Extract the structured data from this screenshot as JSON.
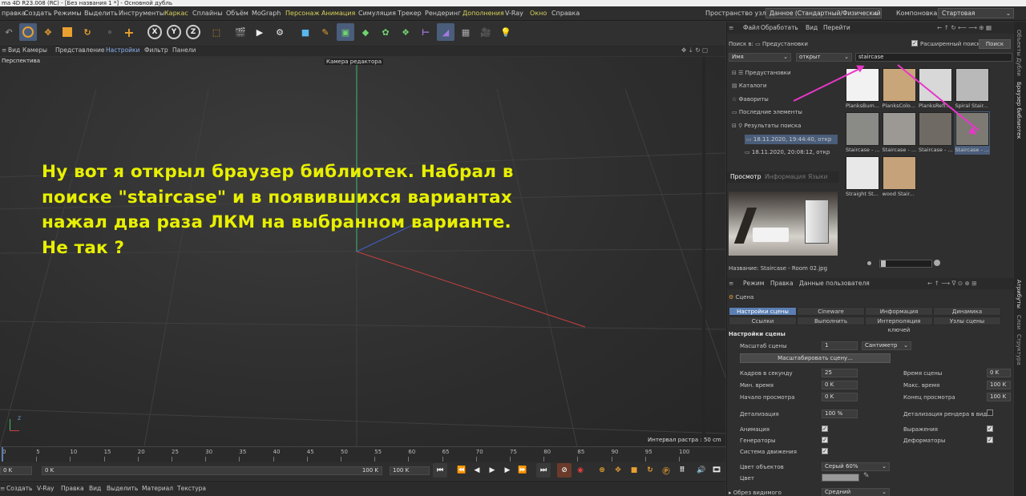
{
  "window": {
    "title": "ma 4D R23.008 (RC) - [Без названия 1 *] - Основной дубль"
  },
  "menubar": {
    "items": [
      "правка",
      "Создать",
      "Режимы",
      "Выделить",
      "Инструменты",
      "Каркас",
      "Сплайны",
      "Объём",
      "MoGraph",
      "Персонаж",
      "Анимация",
      "Симуляция",
      "Трекер",
      "Рендеринг",
      "Дополнения",
      "V-Ray",
      "Окно",
      "Справка"
    ],
    "node_space_label": "Пространство узлов:",
    "node_space_value": "Данное (Стандартный/Физический)",
    "layout_label": "Компоновка",
    "layout_value": "Стартовая"
  },
  "toolbar": {
    "icons": [
      "undo-icon",
      "select-icon",
      "move-icon",
      "scale-icon",
      "rotate-icon",
      "pen-icon",
      "add-icon",
      "x-axis-icon",
      "y-axis-icon",
      "z-axis-icon",
      "coord-system-icon",
      "clapper-icon",
      "render-view-icon",
      "render-settings-icon",
      "cube-icon",
      "pen-tool-icon",
      "subdivision-icon",
      "extrude-icon",
      "cloner-icon",
      "mograph-icon",
      "deformer-icon",
      "spline-icon",
      "floor-icon",
      "camera-icon",
      "light-icon"
    ],
    "xyz": [
      "X",
      "Y",
      "Z"
    ]
  },
  "viewport": {
    "menu": [
      "Вид",
      "Камеры",
      "Представление",
      "Настройки",
      "Фильтр",
      "Панели"
    ],
    "perspective_label": "Перспектива",
    "camera_label": "Камера редактора",
    "grid_spacing": "Интервал растра : 50 cm",
    "annotation": [
      "Ну вот я открыл браузер библиотек. Набрал в",
      "поиске \"staircase\" и в появившихся вариантах",
      "нажал два раза ЛКМ на выбранном варианте.",
      "Не так ?"
    ]
  },
  "timeline": {
    "ticks": [
      "0",
      "5",
      "10",
      "15",
      "20",
      "25",
      "30",
      "35",
      "40",
      "45",
      "50",
      "55",
      "60",
      "65",
      "70",
      "75",
      "80",
      "85",
      "90",
      "95",
      "100"
    ],
    "current_frame": "0 K",
    "start_field": "0 K",
    "end_field": "100 K",
    "end_field2": "100 K"
  },
  "bottom_menu": [
    "Создать",
    "V-Ray",
    "Правка",
    "Вид",
    "Выделить",
    "Материал",
    "Текстура"
  ],
  "content_browser": {
    "menu": [
      "Файл",
      "Обработать",
      "Вид",
      "Перейти"
    ],
    "search_in_label": "Поиск в:",
    "search_in_value": "Предустановки",
    "extended_search_label": "Расширенный поиск",
    "extended_search_checked": true,
    "search_button": "Поиск",
    "field_name": "Имя",
    "field_op": "открыт",
    "search_value": "staircase",
    "tree": [
      {
        "label": "Предустановки",
        "indent": 1
      },
      {
        "label": "Каталоги",
        "indent": 1
      },
      {
        "label": "Фавориты",
        "indent": 1
      },
      {
        "label": "Последние элементы",
        "indent": 1
      },
      {
        "label": "Результаты поиска",
        "indent": 1
      },
      {
        "label": "18.11.2020, 19:44:40, откр",
        "indent": 2,
        "selected": true
      },
      {
        "label": "18.11.2020, 20:08:12, откр",
        "indent": 2,
        "selected": false
      }
    ],
    "results": [
      {
        "label": "PlanksBum...",
        "color": "#f2f2f2",
        "selected": false
      },
      {
        "label": "PlanksColo...",
        "color": "#c9a57a",
        "selected": false
      },
      {
        "label": "PlanksRefl...",
        "color": "#d8d8d8",
        "selected": false
      },
      {
        "label": "Spiral Stair...",
        "color": "#b9b9b9",
        "selected": false
      },
      {
        "label": "Staircase - ...",
        "color": "#8a8a86",
        "selected": false
      },
      {
        "label": "Staircase - ...",
        "color": "#9c9893",
        "selected": false
      },
      {
        "label": "Staircase - ...",
        "color": "#6f6a64",
        "selected": false
      },
      {
        "label": "Staircase - ...",
        "color": "#7d7a74",
        "selected": true
      },
      {
        "label": "Straight St...",
        "color": "#e8e8e8",
        "selected": false
      },
      {
        "label": "wood Stair...",
        "color": "#c6a27a",
        "selected": false
      }
    ],
    "preview_tabs": [
      "Просмотр",
      "Информация",
      "Языки"
    ],
    "preview_name_label": "Название:",
    "preview_name_value": "Staircase - Room 02.jpg"
  },
  "attributes": {
    "menu": [
      "Режим",
      "Правка",
      "Данные пользователя"
    ],
    "object_name": "Сцена",
    "tabs_row1": [
      "Настройки сцены",
      "Cineware",
      "Информация",
      "Динамика"
    ],
    "tabs_row2": [
      "Ссылки",
      "Выполнить",
      "Интерполяция ключей",
      "Узлы сцены"
    ],
    "section_title": "Настройки сцены",
    "scale_label": "Масштаб сцены",
    "scale_value": "1",
    "scale_unit": "Сантиметр",
    "scale_button": "Масштабировать сцену...",
    "fps_label": "Кадров в секунду",
    "fps_value": "25",
    "scene_time_label": "Время сцены",
    "scene_time_value": "0 K",
    "min_time_label": "Мин. время",
    "min_time_value": "0 K",
    "max_time_label": "Макс. время",
    "max_time_value": "100 K",
    "preview_start_label": "Начало просмотра",
    "preview_start_value": "0 K",
    "preview_end_label": "Конец просмотра",
    "preview_end_value": "100 K",
    "lod_label": "Детализация",
    "lod_value": "100 %",
    "render_lod_label": "Детализация рендера в виде",
    "animation_label": "Анимация",
    "expressions_label": "Выражения",
    "generators_label": "Генераторы",
    "deformers_label": "Деформаторы",
    "motion_label": "Система движения",
    "obj_color_label": "Цвет объектов",
    "obj_color_value": "Серый 60%",
    "color_label": "Цвет",
    "clip_label": "Обрез видимого",
    "clip_value": "Средний"
  },
  "side_tabs": [
    "Объекты",
    "Дубли",
    "Браузер библиотек",
    "Атрибуты",
    "Слои",
    "Структура"
  ],
  "colors": {
    "accent": "#5b7fb3",
    "annotation": "#e8f000",
    "arrow": "#e837c8",
    "selection": "#4a5d7a"
  }
}
